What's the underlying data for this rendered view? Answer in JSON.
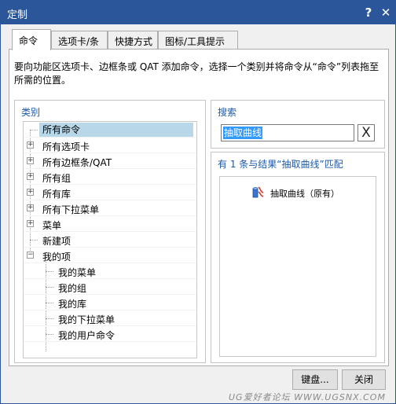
{
  "window": {
    "title": "定制",
    "help": "?",
    "close": "✕"
  },
  "tabs": [
    {
      "label": "命令",
      "active": true
    },
    {
      "label": "选项卡/条"
    },
    {
      "label": "快捷方式"
    },
    {
      "label": "图标/工具提示"
    }
  ],
  "description": "要向功能区选项卡、边框条或 QAT 添加命令，选择一个类别并将命令从“命令”列表拖至所需的位置。",
  "category": {
    "title": "类别",
    "items": [
      {
        "label": "所有命令",
        "selected": true
      },
      {
        "label": "所有选项卡",
        "expander": "+"
      },
      {
        "label": "所有边框条/QAT",
        "expander": "+"
      },
      {
        "label": "所有组",
        "expander": "+"
      },
      {
        "label": "所有库",
        "expander": "+"
      },
      {
        "label": "所有下拉菜单",
        "expander": "+"
      },
      {
        "label": "菜单",
        "expander": "+"
      },
      {
        "label": "新建项"
      },
      {
        "label": "我的项",
        "expander": "−"
      },
      {
        "label": "我的菜单"
      },
      {
        "label": "我的组"
      },
      {
        "label": "我的库"
      },
      {
        "label": "我的下拉菜单"
      },
      {
        "label": "我的用户命令"
      }
    ]
  },
  "search": {
    "title": "搜索",
    "value": "抽取曲线",
    "clear": "X"
  },
  "results": {
    "title": "有 1 条与结果“抽取曲线”匹配",
    "items": [
      {
        "label": "抽取曲线（原有）",
        "icon": "extract-curve-icon"
      }
    ]
  },
  "buttons": {
    "keyboard": "键盘...",
    "close": "关闭"
  },
  "watermark": "UG爱好者论坛 WWW.UGSNX.COM"
}
